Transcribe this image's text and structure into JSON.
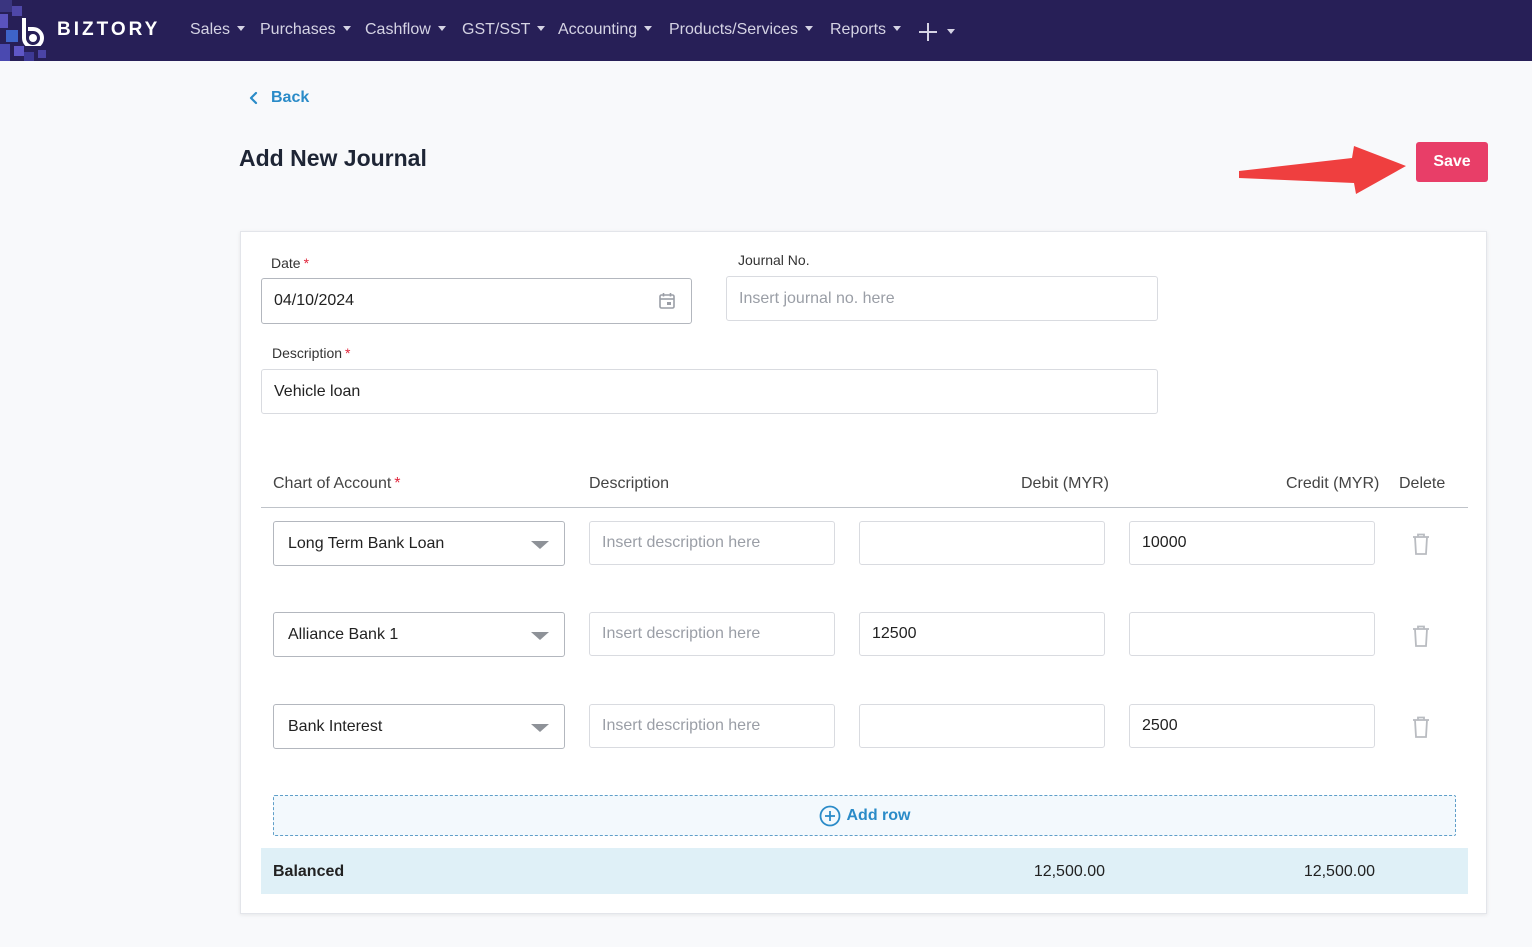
{
  "nav": {
    "brand": "BIZTORY",
    "items": [
      {
        "label": "Sales"
      },
      {
        "label": "Purchases"
      },
      {
        "label": "Cashflow"
      },
      {
        "label": "GST/SST"
      },
      {
        "label": "Accounting"
      },
      {
        "label": "Products/Services"
      },
      {
        "label": "Reports"
      }
    ],
    "plus_icon": "plus-icon",
    "bg_color": "#271f57"
  },
  "back_label": "Back",
  "page_title": "Add New Journal",
  "save_label": "Save",
  "save_color": "#e83e68",
  "annotation_arrow_color": "#ef3f3f",
  "form": {
    "date_label": "Date",
    "date_value": "04/10/2024",
    "journal_label": "Journal No.",
    "journal_placeholder": "Insert journal no. here",
    "description_label": "Description",
    "description_value": "Vehicle loan",
    "required_mark": "*"
  },
  "table": {
    "headers": {
      "account": "Chart of Account",
      "description": "Description",
      "debit": "Debit (MYR)",
      "credit": "Credit (MYR)",
      "delete": "Delete"
    },
    "desc_placeholder": "Insert description here",
    "rows": [
      {
        "account": "Long Term Bank Loan",
        "description": "",
        "debit": "",
        "credit": "10000"
      },
      {
        "account": "Alliance Bank 1",
        "description": "",
        "debit": "12500",
        "credit": ""
      },
      {
        "account": "Bank Interest",
        "description": "",
        "debit": "",
        "credit": "2500"
      }
    ],
    "add_row_label": "Add row",
    "footer": {
      "label": "Balanced",
      "debit_total": "12,500.00",
      "credit_total": "12,500.00"
    }
  }
}
